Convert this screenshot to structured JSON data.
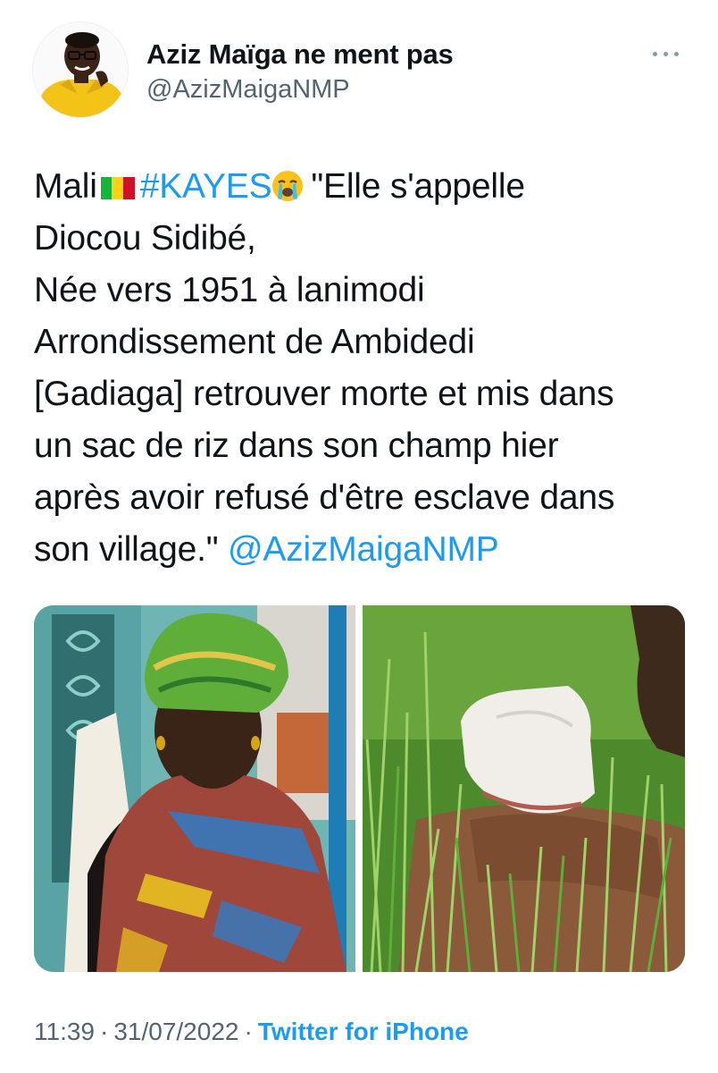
{
  "author": {
    "display_name": "Aziz Maïga ne ment pas",
    "handle": "@AzizMaigaNMP",
    "avatar_icon": "avatar-man-yellow-shirt"
  },
  "header": {
    "more_icon": "more-horizontal-icon"
  },
  "tweet": {
    "line1": {
      "country": "Mali",
      "flag_icon": "flag-mali-icon",
      "hashtag": "#KAYES",
      "emoji_icon": "loudly-crying-face-icon",
      "text": "\"Elle s'appelle"
    },
    "line2": "Diocou Sidibé,",
    "line3": "Née vers 1951 à lanimodi",
    "line4": "Arrondissement de Ambidedi",
    "line5": "[Gadiaga] retrouver morte et mis dans",
    "line6": "un sac de riz dans son champ hier",
    "line7": "après avoir refusé d'être esclave dans",
    "line8": {
      "text": "son village.\"",
      "mention": "@AzizMaigaNMP"
    }
  },
  "media": {
    "photo_left_icon": "photo-elderly-woman",
    "photo_right_icon": "photo-sack-in-grass"
  },
  "meta": {
    "time": "11:39",
    "separator": "·",
    "date": "31/07/2022",
    "source": "Twitter for iPhone"
  },
  "colors": {
    "link": "#1d9bf0",
    "text": "#0f1419",
    "muted": "#536471",
    "flag_green": "#14b53a",
    "flag_yellow": "#fcd116",
    "flag_red": "#ce1126"
  }
}
